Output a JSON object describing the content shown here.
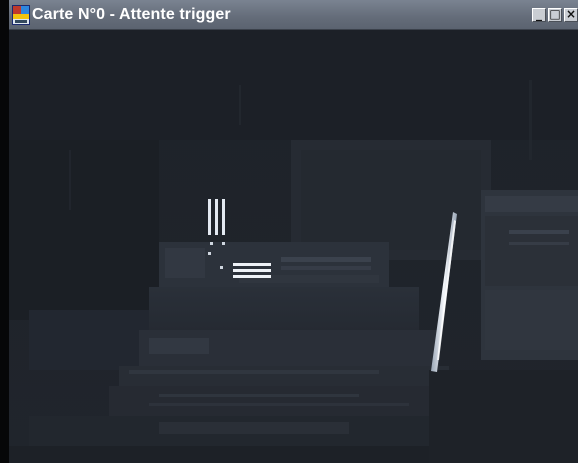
{
  "window": {
    "title": "Carte N°0 - Attente trigger",
    "controls": {
      "minimize_label": "_",
      "maximize_label": "□",
      "close_label": "×"
    }
  },
  "camera_view": {
    "kind": "grayscale camera frame",
    "palette": {
      "background": "#1d2128",
      "mid": "#2a3039",
      "light": "#3a414c",
      "highlight": "#e9eef5"
    }
  }
}
